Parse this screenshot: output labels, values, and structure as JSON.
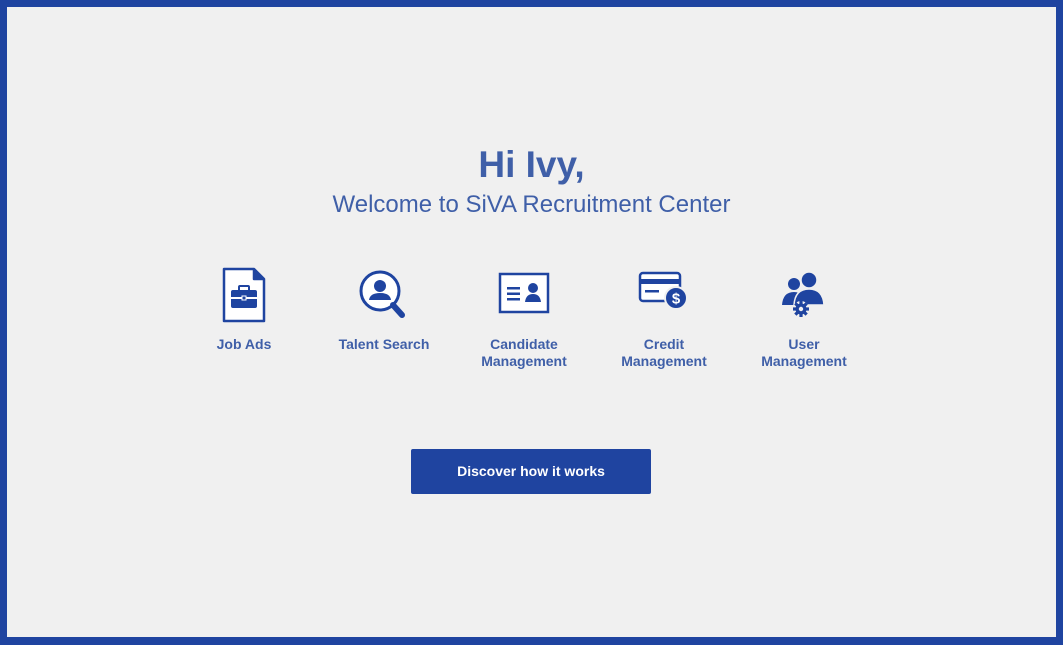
{
  "hero": {
    "greeting": "Hi Ivy,",
    "welcome": "Welcome to SiVA Recruitment Center"
  },
  "tiles": [
    {
      "label": "Job Ads",
      "icon": "document-briefcase-icon"
    },
    {
      "label": "Talent Search",
      "icon": "search-person-icon"
    },
    {
      "label": "Candidate\nManagement",
      "icon": "id-card-icon"
    },
    {
      "label": "Credit\nManagement",
      "icon": "credit-card-dollar-icon"
    },
    {
      "label": "User\nManagement",
      "icon": "users-gear-icon"
    }
  ],
  "cta": {
    "label": "Discover how it works"
  },
  "colors": {
    "brand": "#1f44a0",
    "text": "#3f5fa8",
    "background": "#f0f0f0",
    "button_text": "#ffffff"
  }
}
